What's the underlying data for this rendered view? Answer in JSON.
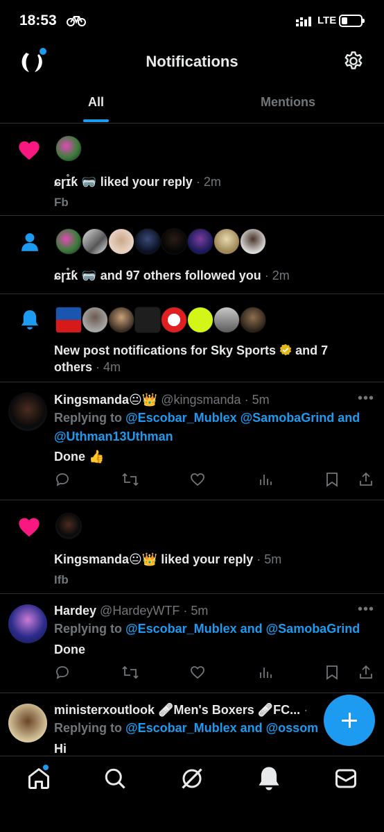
{
  "status_bar": {
    "time": "18:53",
    "network": "LTE"
  },
  "header": {
    "title": "Notifications"
  },
  "tabs": [
    {
      "label": "All"
    },
    {
      "label": "Mentions"
    }
  ],
  "notifications": [
    {
      "kind": "like",
      "actor": "ɕɼɪ̊ƙ 🥽",
      "action": "liked your reply",
      "time": "· 2m",
      "subtext": "Fb"
    },
    {
      "kind": "follow",
      "actor": "ɕɼɪ̊ƙ 🥽",
      "action": "and 97 others followed you",
      "time": "· 2m"
    },
    {
      "kind": "post-notifications",
      "text_1": "New post notifications for Sky Sports",
      "text_2": "and 7",
      "text_3": "others",
      "time": "· 4m"
    },
    {
      "kind": "like",
      "actor": "Kingsmanda😐👑",
      "action": "liked your reply",
      "time": "· 5m",
      "subtext": "Ifb"
    }
  ],
  "posts": [
    {
      "name": "Kingsmanda😐👑",
      "handle": "@kingsmanda",
      "time": "· 5m",
      "replying_prefix": "Replying to",
      "replying_to_1": "@Escobar_Mublex @SamobaGrind and",
      "replying_to_2": "@Uthman13Uthman",
      "body": "Done 👍"
    },
    {
      "name": "Hardey",
      "handle": "@HardeyWTF",
      "time": "· 5m",
      "replying_prefix": "Replying to",
      "replying_to_1": "@Escobar_Mublex and @SamobaGrind",
      "body": "Done"
    },
    {
      "name": "ministerxoutlook 🩹Men's Boxers 🩹FC...",
      "handle": "",
      "time": "·",
      "replying_prefix": "Replying to",
      "replying_to_1": "@Escobar_Mublex and @ossom",
      "body": "Hi"
    }
  ],
  "more_label": "•••",
  "colors": {
    "accent": "#1d9bf0",
    "like": "#f91880",
    "background": "#000000",
    "muted": "#71767b"
  },
  "icons": [
    "bike-icon",
    "signal-icon",
    "battery-icon",
    "gear-icon",
    "heart-icon",
    "person-icon",
    "bell-icon",
    "verified-badge-icon",
    "reply-icon",
    "retweet-icon",
    "like-icon",
    "views-icon",
    "bookmark-icon",
    "share-icon",
    "home-icon",
    "search-icon",
    "grok-icon",
    "messages-icon",
    "compose-icon"
  ]
}
